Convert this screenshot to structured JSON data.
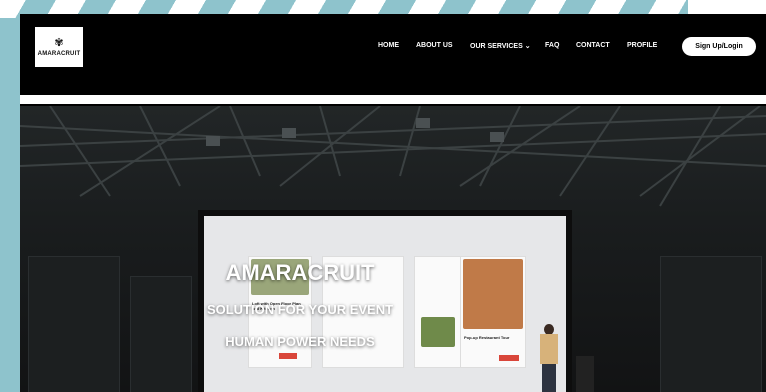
{
  "brand": {
    "logo_text": "AMARACRUIT",
    "logo_icon": "flower-logo-icon"
  },
  "nav": {
    "items": [
      {
        "label": "HOME"
      },
      {
        "label": "ABOUT US"
      },
      {
        "label": "OUR SERVICES ⌄"
      },
      {
        "label": "FAQ"
      },
      {
        "label": "CONTACT"
      },
      {
        "label": "PROFILE"
      }
    ],
    "signup_label": "Sign Up/Login"
  },
  "hero": {
    "title": "AMARACRUIT",
    "line1": "SOLUTION FOR YOUR EVENT",
    "line2": "HUMAN POWER NEEDS"
  },
  "screen_content": {
    "card_left_title": "Loft with Open Floor Plan and Kitchen",
    "card_right_title": "Pop-up Restaurant Tour"
  },
  "colors": {
    "page_bg": "#8ec3cc",
    "nav_bg": "#000000",
    "button_bg": "#ffffff",
    "accent_red": "#d9463a"
  }
}
